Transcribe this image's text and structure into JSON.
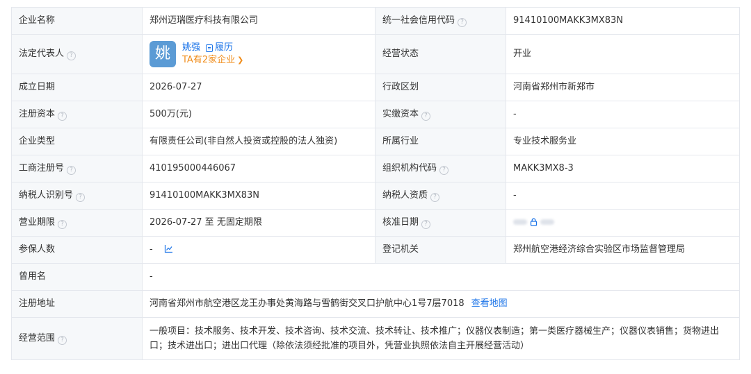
{
  "rows": [
    {
      "l1": "企业名称",
      "v1": "郑州迈瑞医疗科技有限公司",
      "l2": "统一社会信用代码",
      "v2": "91410100MAKK3MX83N"
    },
    {
      "l1": "法定代表人",
      "avatar_char": "姚",
      "rep_name": "姚强",
      "resume": "履历",
      "rep_companies": "TA有2家企业",
      "l2": "经营状态",
      "v2": "开业"
    },
    {
      "l1": "成立日期",
      "v1": "2026-07-27",
      "l2": "行政区划",
      "v2": "河南省郑州市新郑市"
    },
    {
      "l1": "注册资本",
      "v1": "500万(元)",
      "l2": "实缴资本",
      "v2": "-"
    },
    {
      "l1": "企业类型",
      "v1": "有限责任公司(非自然人投资或控股的法人独资)",
      "l2": "所属行业",
      "v2": "专业技术服务业"
    },
    {
      "l1": "工商注册号",
      "v1": "410195000446067",
      "l2": "组织机构代码",
      "v2": "MAKK3MX8-3"
    },
    {
      "l1": "纳税人识别号",
      "v1": "91410100MAKK3MX83N",
      "l2": "纳税人资质",
      "v2": "-"
    },
    {
      "l1": "营业期限",
      "v1": "2026-07-27 至 无固定期限",
      "l2": "核准日期",
      "v2": ""
    },
    {
      "l1": "参保人数",
      "v1": "-",
      "l2": "登记机关",
      "v2": "郑州航空港经济综合实验区市场监督管理局"
    },
    {
      "l1": "曾用名",
      "v1": "-"
    },
    {
      "l1": "注册地址",
      "v1": "河南省郑州市航空港区龙王办事处黄海路与雪鹤街交叉口护航中心1号7层7018",
      "map_link": "查看地图"
    },
    {
      "l1": "经营范围",
      "v1": "一般项目：技术服务、技术开发、技术咨询、技术交流、技术转让、技术推广；仪器仪表制造；第一类医疗器械生产；仪器仪表销售；货物进出口；技术进出口；进出口代理（除依法须经批准的项目外，凭营业执照依法自主开展经营活动）"
    }
  ],
  "help_icon_glyph": "?",
  "icons": {
    "help": "question-circle-icon",
    "resume": "document-icon",
    "chevron": "chevron-right-icon",
    "trend": "line-chart-icon",
    "lock": "lock-icon"
  },
  "colors": {
    "label_bg": "#f6f8fa",
    "border": "#e4e7ed",
    "link": "#1a73e8",
    "accent_orange": "#f08c1a",
    "avatar_bg": "#5b9bd5"
  }
}
